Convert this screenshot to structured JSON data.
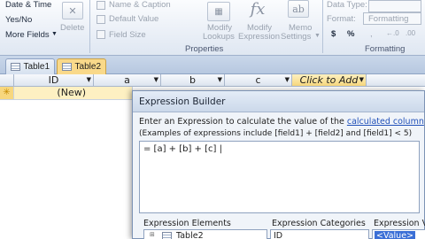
{
  "ribbon": {
    "date_time": "Date & Time",
    "yes_no": "Yes/No",
    "more_fields": "More Fields",
    "delete": "Delete",
    "name_caption": "Name & Caption",
    "default_value": "Default Value",
    "field_size": "Field Size",
    "modify_lookups": [
      "Modify",
      "Lookups"
    ],
    "modify_expression": [
      "Modify",
      "Expression"
    ],
    "memo_settings": [
      "Memo",
      "Settings"
    ],
    "properties_label": "Properties",
    "data_type": "Data Type:",
    "format_label": "Format:",
    "formatting_box": "Formatting",
    "currency_symbol": "$",
    "percent_symbol": "%",
    "formatting_label": "Formatting",
    "fx_glyph": "fx",
    "memo_glyph": "ab"
  },
  "tabs": [
    {
      "label": "Table1",
      "active": false
    },
    {
      "label": "Table2",
      "active": true
    }
  ],
  "datasheet": {
    "columns": [
      "ID",
      "a",
      "b",
      "c"
    ],
    "click_to_add": "Click to Add",
    "new_row_marker": "✳",
    "new_row_value": "(New)"
  },
  "dialog": {
    "title": "Expression Builder",
    "instruction_prefix": "Enter an Expression to calculate the value of the ",
    "instruction_link": "calculated column",
    "instruction_suffix": ":",
    "examples": "(Examples of expressions include [field1] + [field2] and [field1] < 5)",
    "expression": "= [a] + [b] + [c] |",
    "elements_label": "Expression Elements",
    "categories_label": "Expression Categories",
    "values_label": "Expression Va",
    "element_item": "Table2",
    "category_item": "ID",
    "value_item": "<Value>"
  },
  "colors": {
    "active_tab": "#f9d98a",
    "click_to_add_bg": "#fbe6a8",
    "new_row_bg": "#fdf0c2",
    "selected_value_bg": "#3b6fd6"
  }
}
